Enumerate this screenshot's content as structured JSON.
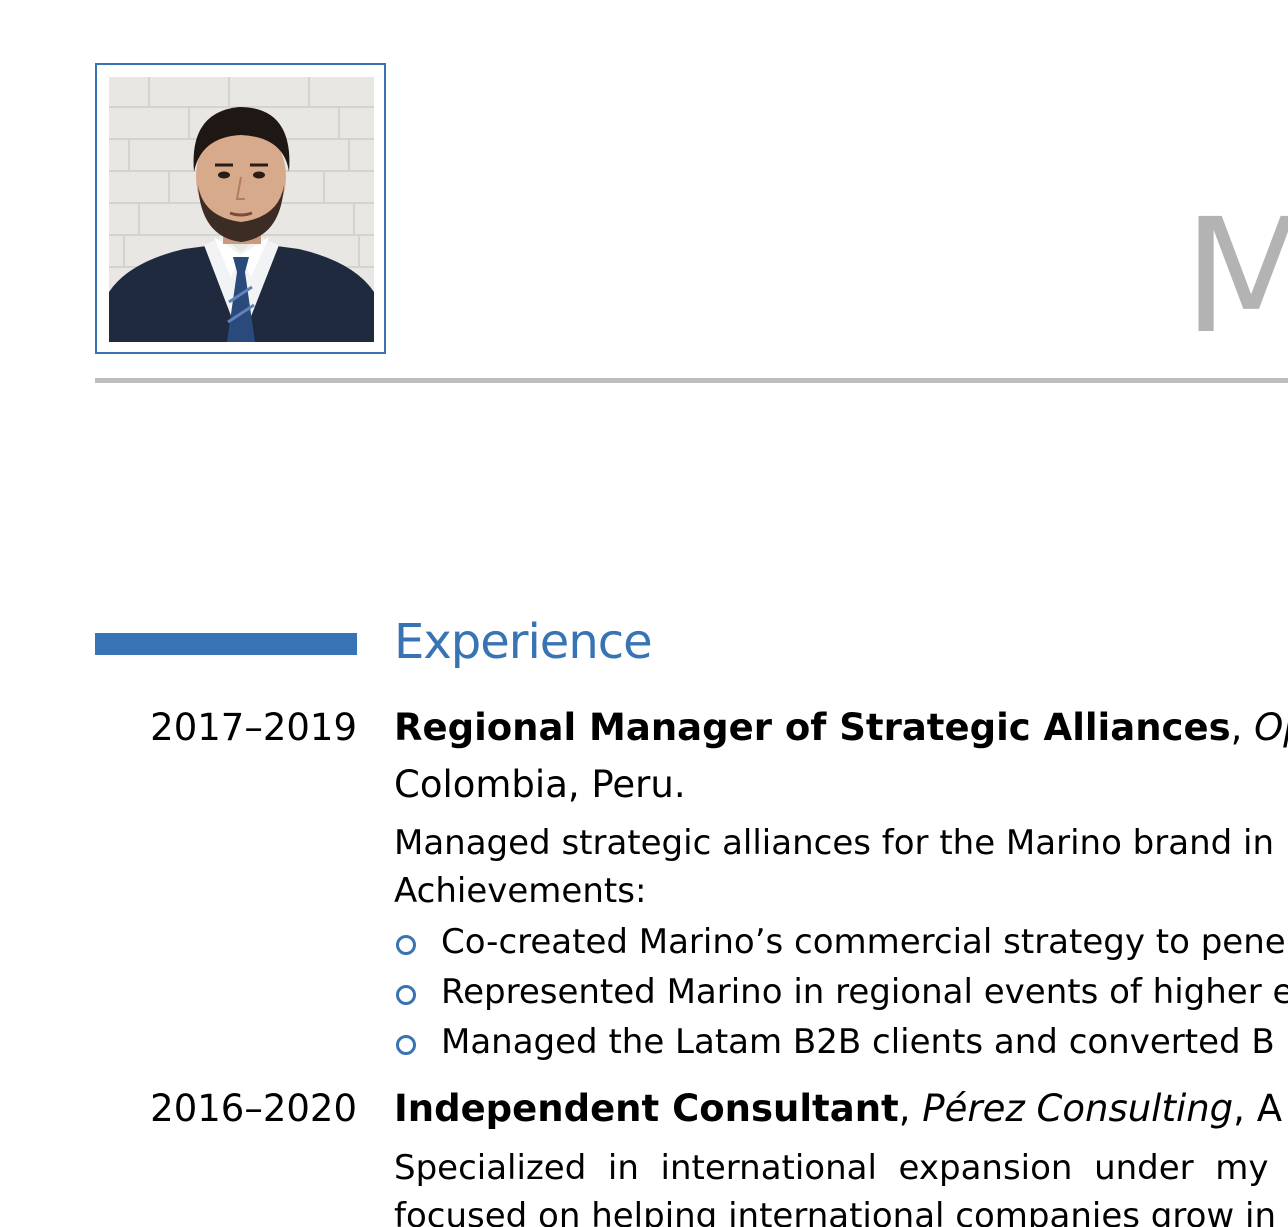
{
  "header": {
    "photo_icon": "portrait-photo",
    "name_visible": "M"
  },
  "experience": {
    "title": "Experience",
    "entries": [
      {
        "date": "2017–2019",
        "role": "Regional Manager of Strategic Alliances",
        "sep1": ", ",
        "org": "Op",
        "line2": "Colombia, Peru.",
        "desc1": "Managed strategic alliances for the Marino brand in",
        "desc2": "Achievements:",
        "bullets": [
          "Co-created Marino’s commercial strategy to pene",
          "Represented Marino in regional events of higher e",
          "Managed the Latam B2B clients and converted B"
        ]
      },
      {
        "date": "2016–2020",
        "role": "Independent Consultant",
        "sep1": ", ",
        "org": "Pérez Consulting",
        "sep2": ", A",
        "desc1": "Specialized  in  international  expansion  under  my  ov",
        "desc2": "focused on helping international companies grow in"
      }
    ]
  },
  "colors": {
    "accent": "#3873b3",
    "name_gray": "#b3b3b3",
    "rule_gray": "#bdbdbd"
  }
}
